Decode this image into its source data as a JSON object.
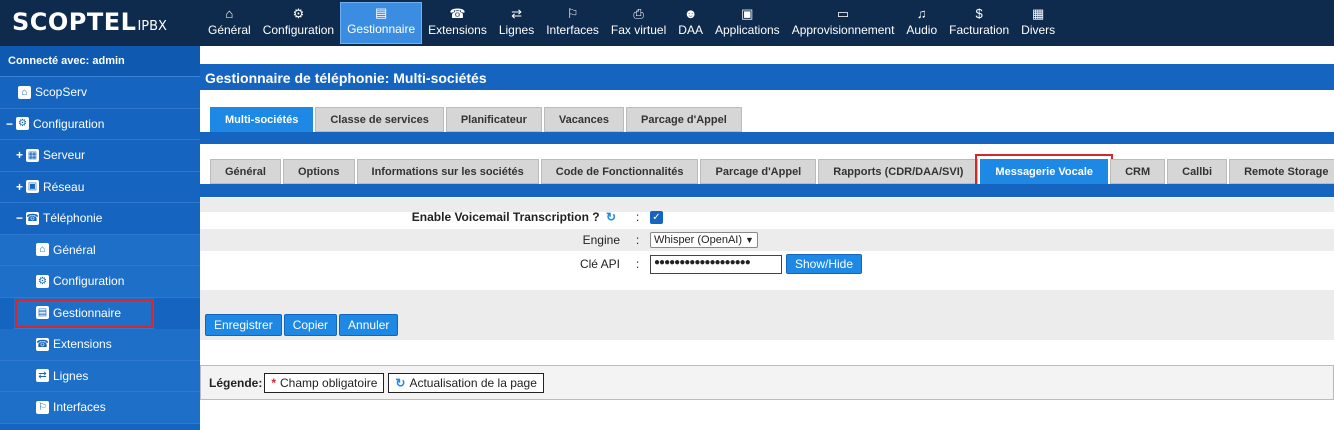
{
  "brand": {
    "name": "SCOPTEL",
    "sub": "IPBX"
  },
  "topnav": [
    {
      "label": "Général",
      "icon": "home-icon",
      "glyph": "⌂"
    },
    {
      "label": "Configuration",
      "icon": "gear-icon",
      "glyph": "⚙"
    },
    {
      "label": "Gestionnaire",
      "icon": "list-icon",
      "glyph": "▤",
      "active": true
    },
    {
      "label": "Extensions",
      "icon": "phone-icon",
      "glyph": "☎"
    },
    {
      "label": "Lignes",
      "icon": "lines-icon",
      "glyph": "⇄"
    },
    {
      "label": "Interfaces",
      "icon": "interface-icon",
      "glyph": "⚐"
    },
    {
      "label": "Fax virtuel",
      "icon": "fax-icon",
      "glyph": "⎙"
    },
    {
      "label": "DAA",
      "icon": "user-icon",
      "glyph": "☻"
    },
    {
      "label": "Applications",
      "icon": "apps-icon",
      "glyph": "▣"
    },
    {
      "label": "Approvisionnement",
      "icon": "provision-icon",
      "glyph": "▭"
    },
    {
      "label": "Audio",
      "icon": "music-icon",
      "glyph": "♫"
    },
    {
      "label": "Facturation",
      "icon": "billing-icon",
      "glyph": "$"
    },
    {
      "label": "Divers",
      "icon": "grid-icon",
      "glyph": "▦"
    }
  ],
  "sidebar": {
    "connected": "Connecté avec: admin",
    "items": [
      {
        "label": "ScopServ",
        "prefix": "",
        "indent": 18,
        "glyph": "⌂",
        "icon": "home-icon"
      },
      {
        "label": "Configuration",
        "prefix": "−",
        "indent": 6,
        "glyph": "⚙",
        "icon": "gear-icon"
      },
      {
        "label": "Serveur",
        "prefix": "+",
        "indent": 16,
        "glyph": "▦",
        "icon": "server-icon"
      },
      {
        "label": "Réseau",
        "prefix": "+",
        "indent": 16,
        "glyph": "▣",
        "icon": "network-icon"
      },
      {
        "label": "Téléphonie",
        "prefix": "−",
        "indent": 16,
        "glyph": "☎",
        "icon": "telephony-icon"
      },
      {
        "label": "Général",
        "prefix": "",
        "indent": 36,
        "glyph": "⌂",
        "icon": "home-icon",
        "lvl3": true
      },
      {
        "label": "Configuration",
        "prefix": "",
        "indent": 36,
        "glyph": "⚙",
        "icon": "gear-icon",
        "lvl3": true
      },
      {
        "label": "Gestionnaire",
        "prefix": "",
        "indent": 36,
        "glyph": "▤",
        "icon": "list-icon",
        "lvl3": true,
        "highlight": true
      },
      {
        "label": "Extensions",
        "prefix": "",
        "indent": 36,
        "glyph": "☎",
        "icon": "phone-icon",
        "lvl3": true
      },
      {
        "label": "Lignes",
        "prefix": "",
        "indent": 36,
        "glyph": "⇄",
        "icon": "lines-icon",
        "lvl3": true
      },
      {
        "label": "Interfaces",
        "prefix": "",
        "indent": 36,
        "glyph": "⚐",
        "icon": "interface-icon",
        "lvl3": true
      }
    ]
  },
  "page": {
    "title": "Gestionnaire de téléphonie:  Multi-sociétés"
  },
  "tabs1": [
    {
      "label": "Multi-sociétés",
      "active": true
    },
    {
      "label": "Classe de services"
    },
    {
      "label": "Planificateur"
    },
    {
      "label": "Vacances"
    },
    {
      "label": "Parcage d'Appel"
    }
  ],
  "tabs2": [
    {
      "label": "Général"
    },
    {
      "label": "Options"
    },
    {
      "label": "Informations sur les sociétés"
    },
    {
      "label": "Code de Fonctionnalités"
    },
    {
      "label": "Parcage d'Appel"
    },
    {
      "label": "Rapports (CDR/DAA/SVI)"
    },
    {
      "label": "Messagerie Vocale",
      "active": true
    },
    {
      "label": "CRM"
    },
    {
      "label": "Callbi"
    },
    {
      "label": "Remote Storage"
    }
  ],
  "form": {
    "transcription_label": "Enable Voicemail Transcription ?",
    "transcription_checked": true,
    "engine_label": "Engine",
    "engine_value": "Whisper (OpenAI)",
    "api_label": "Clé API",
    "api_value": "●●●●●●●●●●●●●●●●●●●",
    "show_hide": "Show/Hide",
    "colon": ":"
  },
  "actions": {
    "save": "Enregistrer",
    "copy": "Copier",
    "cancel": "Annuler"
  },
  "legend": {
    "label": "Légende:",
    "required": "Champ obligatoire",
    "refresh": "Actualisation de la page"
  },
  "colors": {
    "topbar": "#0e2a4d",
    "sidebar": "#1565c0",
    "accent": "#1e88e5",
    "highlight": "#d8262c"
  }
}
